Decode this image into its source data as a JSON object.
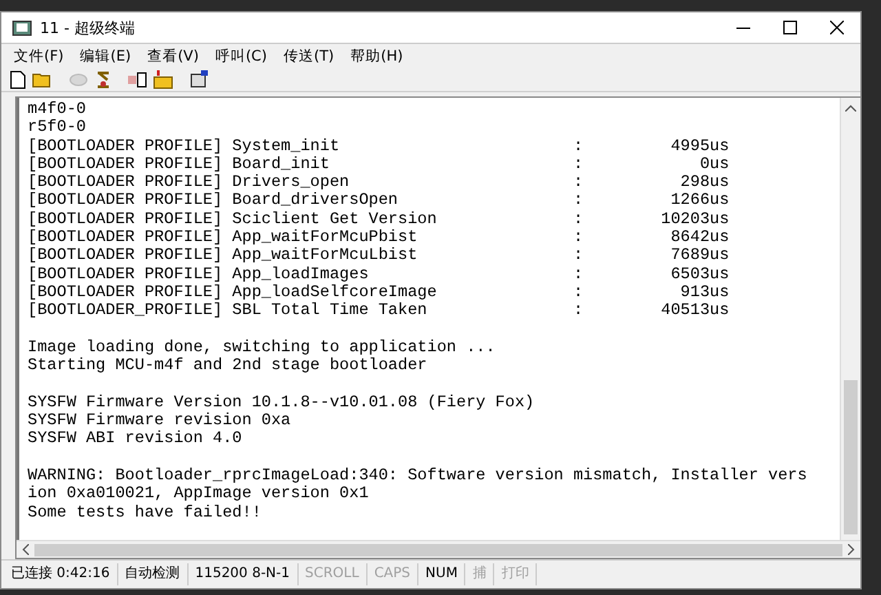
{
  "window": {
    "title": "11 - 超级终端"
  },
  "menu": [
    "文件(F)",
    "编辑(E)",
    "查看(V)",
    "呼叫(C)",
    "传送(T)",
    "帮助(H)"
  ],
  "toolbar": [
    {
      "kind": "new",
      "disabled": false
    },
    {
      "kind": "open",
      "disabled": false
    },
    {
      "kind": "disconnect",
      "disabled": true
    },
    {
      "kind": "call",
      "disabled": false
    },
    {
      "kind": "send",
      "disabled": false
    },
    {
      "kind": "receive",
      "disabled": false
    },
    {
      "kind": "properties",
      "disabled": false
    }
  ],
  "terminal": {
    "blocks": [
      {
        "kind": "profile",
        "lines": [
          "m4f0-0",
          "r5f0-0"
        ],
        "rows": [
          {
            "label": "[BOOTLOADER PROFILE] System_init",
            "separator": ":",
            "value": "4995us"
          },
          {
            "label": "[BOOTLOADER PROFILE] Board_init",
            "separator": ":",
            "value": "0us"
          },
          {
            "label": "[BOOTLOADER PROFILE] Drivers_open",
            "separator": ":",
            "value": "298us"
          },
          {
            "label": "[BOOTLOADER PROFILE] Board_driversOpen",
            "separator": ":",
            "value": "1266us"
          },
          {
            "label": "[BOOTLOADER PROFILE] Sciclient Get Version",
            "separator": ":",
            "value": "10203us"
          },
          {
            "label": "[BOOTLOADER PROFILE] App_waitForMcuPbist",
            "separator": ":",
            "value": "8642us"
          },
          {
            "label": "[BOOTLOADER PROFILE] App_waitForMcuLbist",
            "separator": ":",
            "value": "7689us"
          },
          {
            "label": "[BOOTLOADER PROFILE] App_loadImages",
            "separator": ":",
            "value": "6503us"
          },
          {
            "label": "[BOOTLOADER PROFILE] App_loadSelfcoreImage",
            "separator": ":",
            "value": "913us"
          },
          {
            "label": "[BOOTLOADER_PROFILE] SBL Total Time Taken",
            "separator": ":",
            "value": "40513us"
          }
        ]
      },
      {
        "kind": "text",
        "lines": [
          "Image loading done, switching to application ...",
          "Starting MCU-m4f and 2nd stage bootloader"
        ]
      },
      {
        "kind": "text",
        "lines": [
          "SYSFW Firmware Version 10.1.8--v10.01.08 (Fiery Fox)",
          "SYSFW Firmware revision 0xa",
          "SYSFW ABI revision 4.0"
        ]
      },
      {
        "kind": "text",
        "lines": [
          "WARNING: Bootloader_rprcImageLoad:340: Software version mismatch, Installer vers",
          "ion 0xa010021, AppImage version 0x1",
          "Some tests have failed!!"
        ]
      }
    ]
  },
  "status_bar": [
    {
      "text": "已连接 0:42:16",
      "disabled": false
    },
    {
      "text": "自动检测",
      "disabled": false
    },
    {
      "text": "115200 8-N-1",
      "disabled": false
    },
    {
      "text": "SCROLL",
      "disabled": true
    },
    {
      "text": "CAPS",
      "disabled": true
    },
    {
      "text": "NUM",
      "disabled": false
    },
    {
      "text": "捕",
      "disabled": true
    },
    {
      "text": "打印",
      "disabled": true
    }
  ]
}
